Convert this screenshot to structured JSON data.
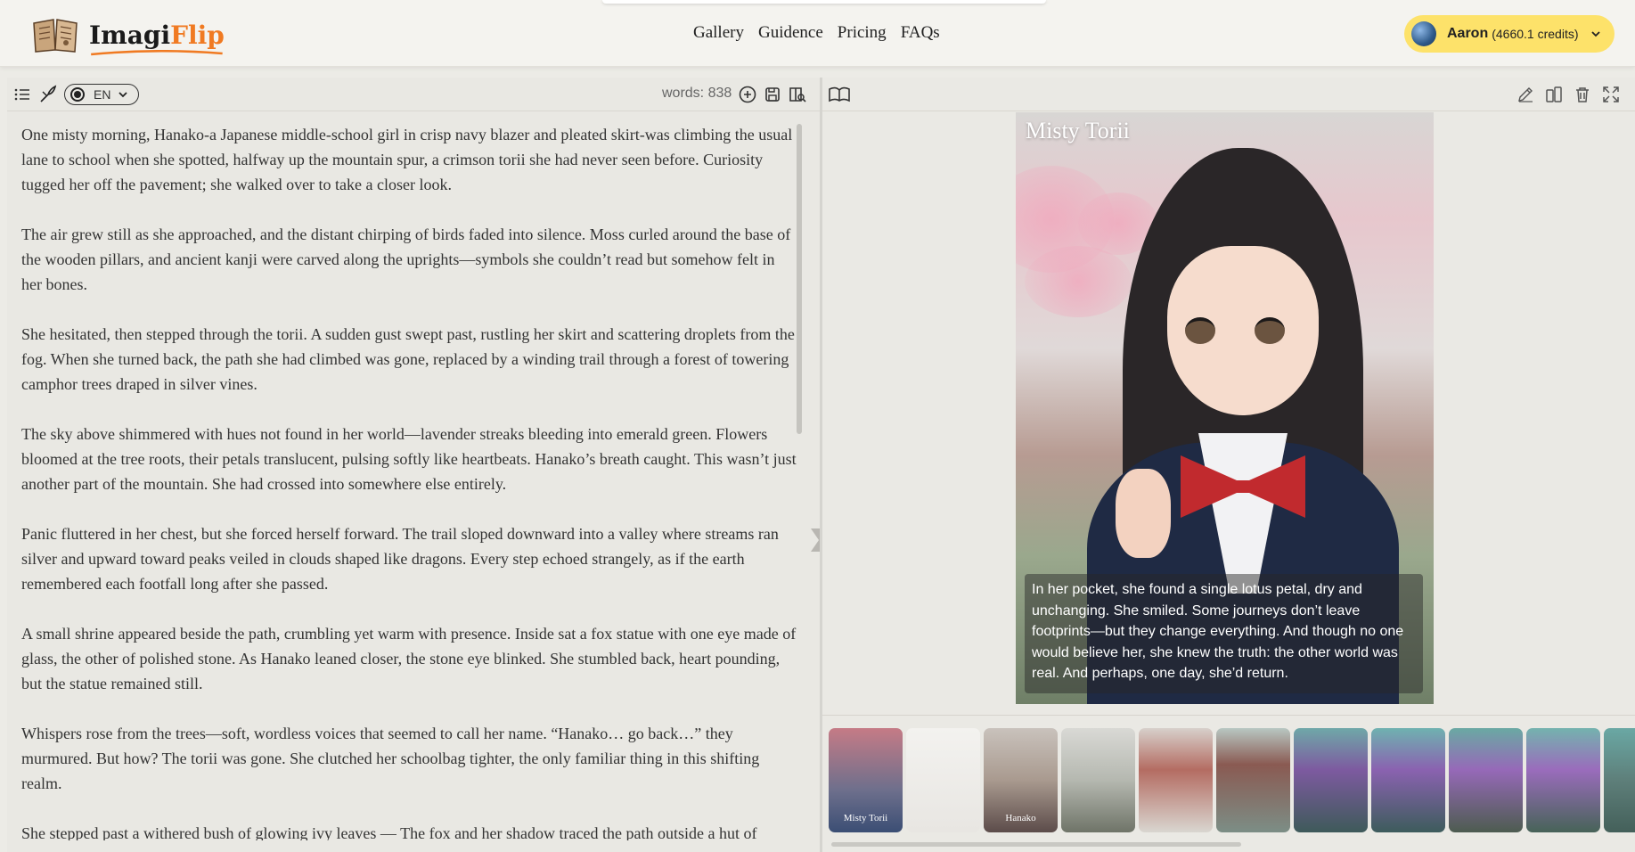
{
  "header": {
    "logo_part1": "Imagi",
    "logo_part2": "Flip",
    "nav": [
      "Gallery",
      "Guidence",
      "Pricing",
      "FAQs"
    ],
    "user_name": "Aaron",
    "user_credits": "(4660.1 credits)"
  },
  "editor": {
    "language": "EN",
    "word_count": "words: 838",
    "paragraphs": [
      "One misty morning, Hanako-a Japanese middle-school girl in crisp navy blazer and pleated skirt-was climbing the usual lane to school when she spotted, halfway up the mountain spur, a crimson torii she had never seen before. Curiosity tugged her off the pavement; she walked over to take a closer look.",
      "The air grew still as she approached, and the distant chirping of birds faded into silence. Moss curled around the base of the wooden pillars, and ancient kanji were carved along the uprights—symbols she couldn’t read but somehow felt in her bones.",
      "She hesitated, then stepped through the torii. A sudden gust swept past, rustling her skirt and scattering droplets from the fog. When she turned back, the path she had climbed was gone, replaced by a winding trail through a forest of towering camphor trees draped in silver vines.",
      "The sky above shimmered with hues not found in her world—lavender streaks bleeding into emerald green. Flowers bloomed at the tree roots, their petals translucent, pulsing softly like heartbeats. Hanako’s breath caught. This wasn’t just another part of the mountain. She had crossed into somewhere else entirely.",
      "Panic fluttered in her chest, but she forced herself forward. The trail sloped downward into a valley where streams ran silver and upward toward peaks veiled in clouds shaped like dragons. Every step echoed strangely, as if the earth remembered each footfall long after she passed.",
      "A small shrine appeared beside the path, crumbling yet warm with presence. Inside sat a fox statue with one eye made of glass, the other of polished stone. As Hanako leaned closer, the stone eye blinked. She stumbled back, heart pounding, but the statue remained still.",
      "Whispers rose from the trees—soft, wordless voices that seemed to call her name. “Hanako… go back…” they murmured. But how? The torii was gone. She clutched her schoolbag tighter, the only familiar thing in this shifting realm.",
      "She stepped past a withered bush of glowing ivy leaves — The fox and her shadow traced the path outside a hut of"
    ]
  },
  "preview": {
    "page_title": "Misty Torii",
    "caption": "In her pocket, she found a single lotus petal, dry and unchanging. She smiled. Some journeys don’t leave footprints—but they change everything. And though no one would believe her, she knew the truth: the other world was real. And perhaps, one day, she’d return.",
    "thumbnails": [
      {
        "label": "Misty Torii",
        "bg": "linear-gradient(180deg,#c57b86,#6d6f8c 60%,#3b4e74)"
      },
      {
        "label": "",
        "bg": "linear-gradient(180deg,#f3f2ef,#e8e6e2)"
      },
      {
        "label": "Hanako",
        "bg": "linear-gradient(180deg,#c9c2bc,#a99a8f 50%,#5c4c4a)"
      },
      {
        "label": "",
        "bg": "linear-gradient(180deg,#d9d9d5,#b5b8b0 50%,#6f7468)"
      },
      {
        "label": "",
        "bg": "linear-gradient(180deg,#d7d0cb,#b46c62 40%,#d9d6d0)"
      },
      {
        "label": "",
        "bg": "linear-gradient(180deg,#b8c7c2,#8a5a52 35%,#7c8e86)"
      },
      {
        "label": "",
        "bg": "linear-gradient(180deg,#6fa8a8,#7d5aa0 40%,#3e5a5a)"
      },
      {
        "label": "",
        "bg": "linear-gradient(180deg,#6fb2b0,#8a62b0 40%,#3d5c5c)"
      },
      {
        "label": "",
        "bg": "linear-gradient(180deg,#6aa9a3,#9669b8 40%,#4d5c50)"
      },
      {
        "label": "",
        "bg": "linear-gradient(180deg,#74b3ae,#9a6cbc 40%,#476358)"
      },
      {
        "label": "",
        "bg": "linear-gradient(180deg,#6aa8a4,#5e7f7a 50%,#44605a)"
      }
    ]
  },
  "colors": {
    "accent": "#f07a22",
    "credit_pill": "#fde26a",
    "bow_red": "#c12a2e",
    "blazer_navy": "#1f2a44"
  }
}
